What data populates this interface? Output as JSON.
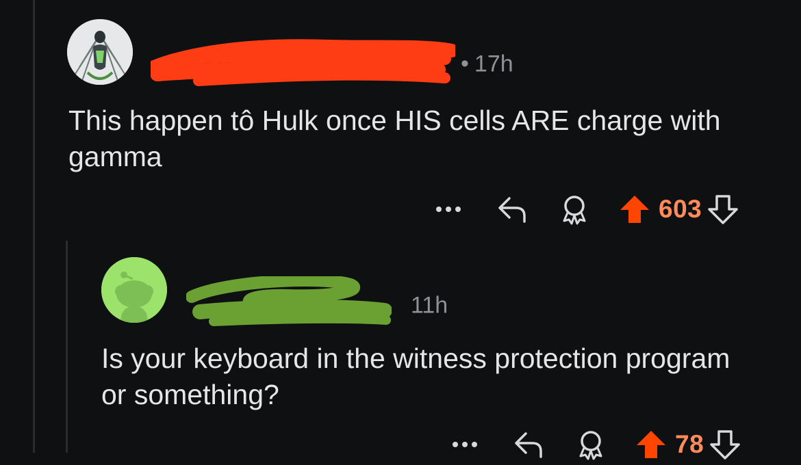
{
  "post": {
    "author_redacted": true,
    "time": "17h",
    "separator": "•",
    "text": "This happen tô Hulk once HIS cells ARE charge with gamma",
    "score": "603",
    "accent_color": "#ff4500",
    "score_color": "#ff8a5c",
    "redaction_color": "#ff3d14"
  },
  "reply": {
    "author_redacted": true,
    "time": "11h",
    "separator": "•",
    "text": "Is your keyboard in the witness protection program or something?",
    "score": "78",
    "redaction_color": "#6aa132",
    "avatar_color": "#9be36b"
  },
  "icons": [
    "more-icon",
    "reply-icon",
    "award-icon",
    "upvote-icon",
    "downvote-icon"
  ]
}
